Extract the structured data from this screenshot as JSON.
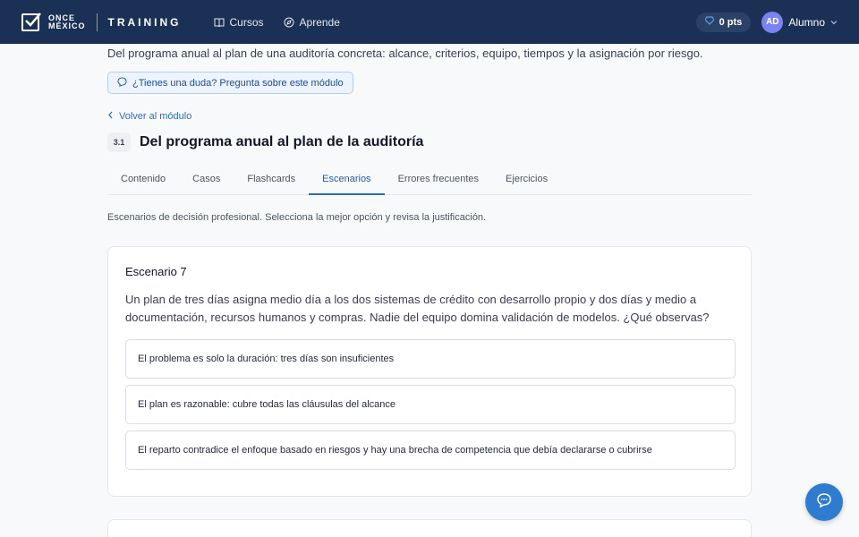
{
  "header": {
    "logo_lines": [
      "ONCE",
      "MÉXICO"
    ],
    "brand": "TRAINING",
    "nav": [
      {
        "label": "Cursos",
        "icon": "book-icon"
      },
      {
        "label": "Aprende",
        "icon": "compass-icon"
      }
    ],
    "points": "0 pts",
    "avatar_initials": "AD",
    "user_name": "Alumno"
  },
  "module": {
    "subtitle": "Del programa anual al plan de una auditoría concreta: alcance, criterios, equipo, tiempos y la asignación por riesgo.",
    "ask_label": "¿Tienes una duda? Pregunta sobre este módulo",
    "back_label": "Volver al módulo",
    "lesson_number": "3.1",
    "title": "Del programa anual al plan de la auditoría"
  },
  "tabs": [
    "Contenido",
    "Casos",
    "Flashcards",
    "Escenarios",
    "Errores frecuentes",
    "Ejercicios"
  ],
  "active_tab": "Escenarios",
  "description": "Escenarios de decisión profesional. Selecciona la mejor opción y revisa la justificación.",
  "scenario": {
    "title": "Escenario 7",
    "question": "Un plan de tres días asigna medio día a los dos sistemas de crédito con desarrollo propio y dos días y medio a documentación, recursos humanos y compras. Nadie del equipo domina validación de modelos. ¿Qué observas?",
    "options": [
      "El problema es solo la duración: tres días son insuficientes",
      "El plan es razonable: cubre todas las cláusulas del alcance",
      "El reparto contradice el enfoque basado en riesgos y hay una brecha de competencia que debía declararse o cubrirse"
    ]
  },
  "colors": {
    "header_bg": "#1b3055",
    "accent": "#2f6bb3",
    "avatar_bg": "#7c83f0",
    "fab_bg": "#2f7bd0"
  }
}
